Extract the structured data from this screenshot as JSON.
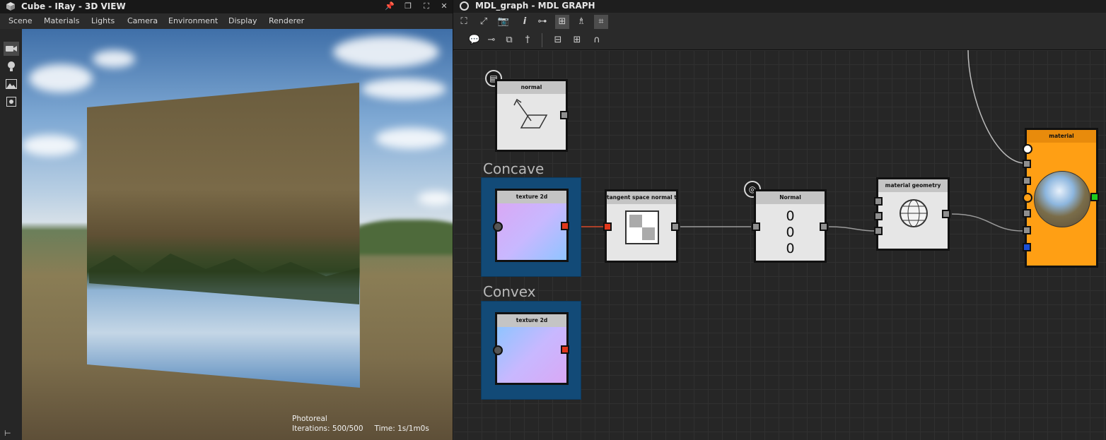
{
  "viewport3d": {
    "title": "Cube - IRay - 3D VIEW",
    "menu": [
      "Scene",
      "Materials",
      "Lights",
      "Camera",
      "Environment",
      "Display",
      "Renderer"
    ],
    "titlebar_icons": [
      "pin-icon",
      "restore-icon",
      "maximize-icon",
      "close-icon"
    ],
    "side_icons": [
      "camera-icon",
      "lightbulb-icon",
      "environment-icon",
      "settings-icon"
    ],
    "render_mode": "Photoreal",
    "iterations": "Iterations: 500/500",
    "time": "Time: 1s/1m0s"
  },
  "graph": {
    "title": "MDL_graph - MDL GRAPH",
    "toolbar_row1": [
      "frame-all-icon",
      "fit-icon",
      "snapshot-icon",
      "info-icon",
      "connect-icon",
      "layout-icon",
      "clean-icon",
      "grid-icon"
    ],
    "toolbar_row2": [
      "comment-icon",
      "reroute-icon",
      "group-icon",
      "pin-icon",
      "align-h-icon",
      "align-v-icon",
      "snap-icon"
    ],
    "groups": {
      "concave": "Concave",
      "convex": "Convex"
    },
    "nodes": {
      "normal": "normal",
      "texture_concave": "texture 2d",
      "tangent": "tangent space normal te...",
      "normal_const": "Normal",
      "normal_values": [
        "0",
        "0",
        "0"
      ],
      "geometry": "material geometry",
      "material": "material",
      "texture_convex": "texture 2d"
    }
  }
}
